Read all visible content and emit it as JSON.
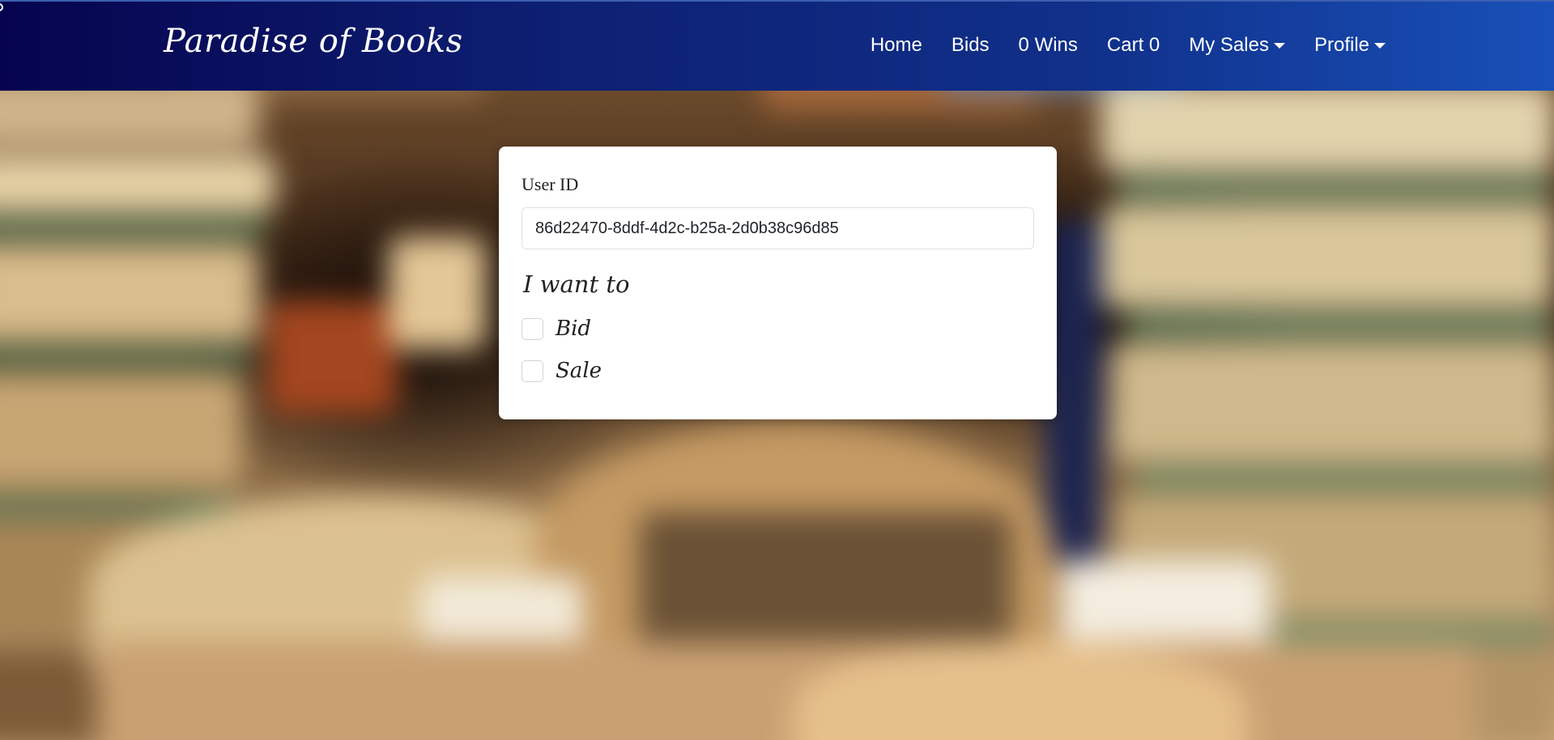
{
  "navbar": {
    "brand": "Paradise of Books",
    "links": [
      {
        "label": "Home"
      },
      {
        "label": "Bids"
      },
      {
        "label": "0 Wins"
      },
      {
        "label": "Cart 0"
      },
      {
        "label": "My Sales",
        "dropdown": true
      },
      {
        "label": "Profile",
        "dropdown": true
      }
    ]
  },
  "form": {
    "user_id_label": "User ID",
    "user_id_value": "86d22470-8ddf-4d2c-b25a-2d0b38c96d85",
    "intent_heading": "I want to",
    "options": [
      {
        "label": "Bid",
        "checked": false
      },
      {
        "label": "Sale",
        "checked": false
      }
    ]
  },
  "colors": {
    "navbar_gradient_start": "#06044e",
    "navbar_gradient_end": "#1850b8",
    "card_background": "#ffffff"
  },
  "icons": {
    "dropdown": "caret-down-icon",
    "checkbox": "checkbox-icon"
  }
}
